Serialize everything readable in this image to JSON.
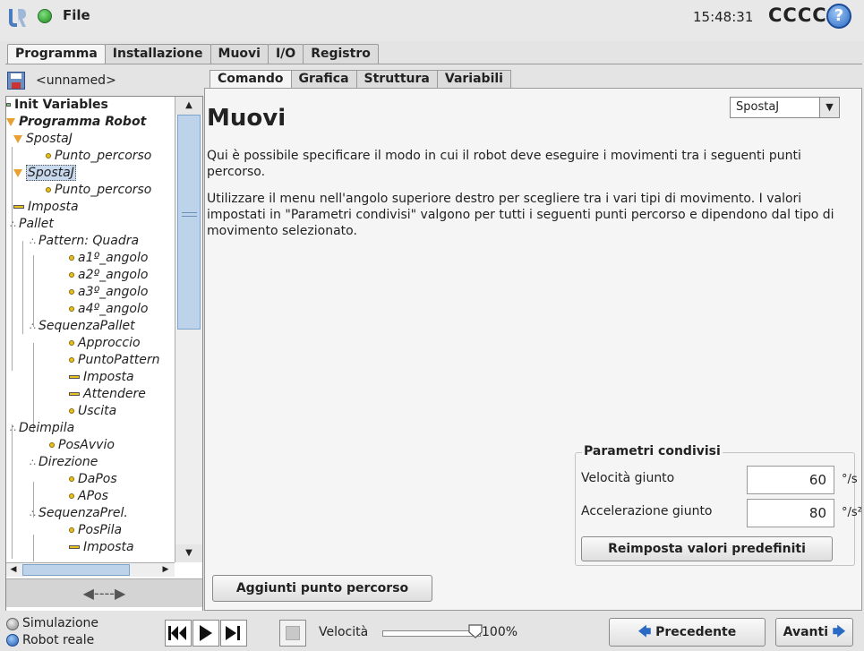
{
  "topbar": {
    "file_menu": "File",
    "clock": "15:48:31",
    "robot_name": "CCCC",
    "help_label": "?"
  },
  "main_tabs": [
    "Programma",
    "Installazione",
    "Muovi",
    "I/O",
    "Registro"
  ],
  "program": {
    "name": "<unnamed>"
  },
  "tree": [
    "Init Variables",
    "Programma Robot",
    "SpostaJ",
    "Punto_percorso",
    "SpostaJ",
    "Punto_percorso",
    "Imposta",
    "Pallet",
    "Pattern: Quadra",
    "a1º_angolo",
    "a2º_angolo",
    "a3º_angolo",
    "a4º_angolo",
    "SequenzaPallet",
    "Approccio",
    "PuntoPattern",
    "Imposta",
    "Attendere",
    "Uscita",
    "Deimpila",
    "PosAvvio",
    "Direzione",
    "DaPos",
    "APos",
    "SequenzaPrel.",
    "PosPila",
    "Imposta"
  ],
  "sub_tabs": [
    "Comando",
    "Grafica",
    "Struttura",
    "Variabili"
  ],
  "command": {
    "title": "Muovi",
    "move_type": "SpostaJ",
    "desc1": "Qui è possibile specificare il modo in cui il robot deve eseguire i movimenti tra i seguenti punti percorso.",
    "desc2": "Utilizzare il menu nell'angolo superiore destro per scegliere tra i vari tipi di movimento. I valori impostati in \"Parametri condivisi\" valgono per tutti i seguenti punti percorso e dipendono dal tipo di movimento selezionato.",
    "params_title": "Parametri condivisi",
    "joint_speed_label": "Velocità giunto",
    "joint_speed_value": "60",
    "joint_speed_unit": "°/s",
    "joint_accel_label": "Accelerazione giunto",
    "joint_accel_value": "80",
    "joint_accel_unit": "°/s²",
    "reset_label": "Reimposta valori predefiniti",
    "add_waypoint_label": "Aggiunti punto percorso"
  },
  "bottom": {
    "simulation_label": "Simulazione",
    "real_robot_label": "Robot reale",
    "speed_label": "Velocità",
    "speed_value": "100%",
    "speed_fraction": 1.0,
    "prev_label": "Precedente",
    "next_label": "Avanti"
  },
  "colors": {
    "accent_blue": "#2a69c4",
    "selection": "#c9d9ee",
    "waypoint": "#e8c020"
  },
  "icons": [
    "ur-logo-icon",
    "status-dot-icon",
    "help-icon",
    "save-icon",
    "waypoint-icon",
    "movej-icon",
    "set-icon",
    "pallet-icon",
    "skip-start-icon",
    "play-icon",
    "step-icon",
    "stop-icon",
    "arrow-left-icon",
    "arrow-right-icon"
  ]
}
